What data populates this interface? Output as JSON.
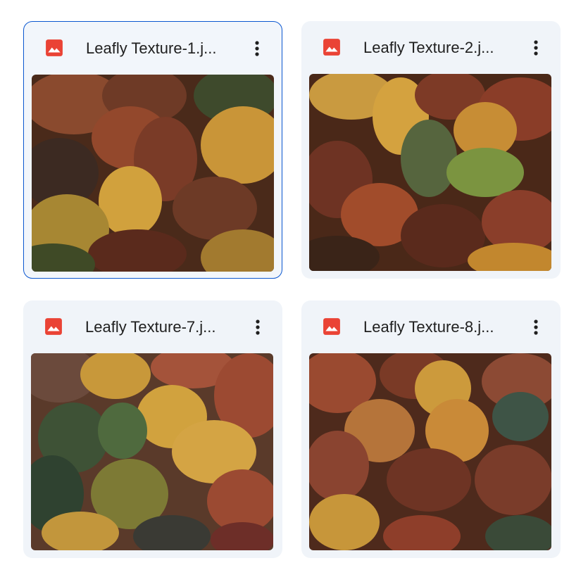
{
  "files": [
    {
      "name": "Leafly Texture-1.j...",
      "icon": "image-file-icon",
      "selected": true
    },
    {
      "name": "Leafly Texture-2.j...",
      "icon": "image-file-icon",
      "selected": false
    },
    {
      "name": "Leafly Texture-7.j...",
      "icon": "image-file-icon",
      "selected": false
    },
    {
      "name": "Leafly Texture-8.j...",
      "icon": "image-file-icon",
      "selected": false
    }
  ],
  "colors": {
    "card_bg": "#f0f4f9",
    "selection_border": "#0b57d0",
    "image_icon": "#ea4335",
    "text": "#1f1f1f"
  }
}
